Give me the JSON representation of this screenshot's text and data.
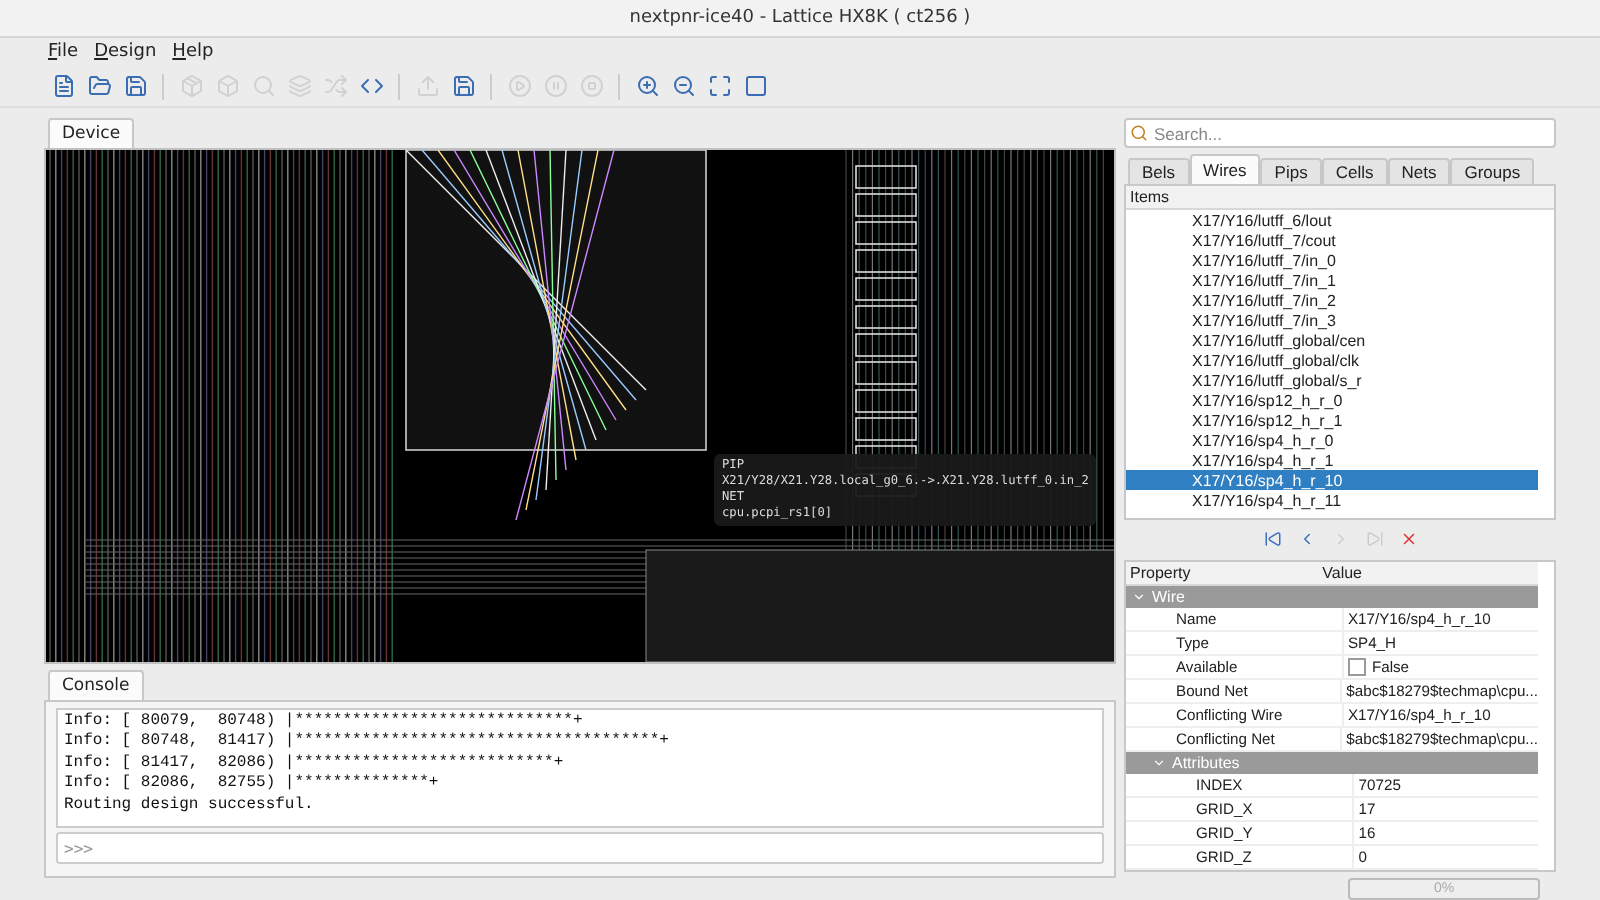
{
  "window": {
    "title": "nextpnr-ice40 - Lattice HX8K ( ct256 )"
  },
  "menu": [
    {
      "label": "File"
    },
    {
      "label": "Design"
    },
    {
      "label": "Help"
    }
  ],
  "toolbar": [
    {
      "kind": "new",
      "disabled": false
    },
    {
      "kind": "open",
      "disabled": false
    },
    {
      "kind": "save",
      "disabled": false
    },
    {
      "kind": "sep"
    },
    {
      "kind": "pack",
      "disabled": true
    },
    {
      "kind": "assign",
      "disabled": true
    },
    {
      "kind": "place",
      "disabled": true
    },
    {
      "kind": "route",
      "disabled": true
    },
    {
      "kind": "shuffle",
      "disabled": true
    },
    {
      "kind": "python",
      "disabled": false
    },
    {
      "kind": "sep"
    },
    {
      "kind": "load",
      "disabled": true
    },
    {
      "kind": "save-file",
      "disabled": false
    },
    {
      "kind": "sep"
    },
    {
      "kind": "play",
      "disabled": true
    },
    {
      "kind": "pause",
      "disabled": true
    },
    {
      "kind": "stop",
      "disabled": true
    },
    {
      "kind": "sep"
    },
    {
      "kind": "zoom-in",
      "disabled": false
    },
    {
      "kind": "zoom-out",
      "disabled": false
    },
    {
      "kind": "zoom-fit",
      "disabled": false
    },
    {
      "kind": "zoom-selected",
      "disabled": false
    }
  ],
  "device_tabs": [
    {
      "label": "Device",
      "selected": true
    }
  ],
  "tooltip": {
    "lines": [
      "PIP",
      "X21/Y28/X21.Y28.local_g0_6.->.X21.Y28.lutff_0.in_2",
      "NET",
      "cpu.pcpi_rs1[0]"
    ]
  },
  "console": {
    "tab": "Console",
    "lines": [
      "Info: [ 80079,  80748) |*****************************+",
      "Info: [ 80748,  81417) |**************************************+",
      "Info: [ 81417,  82086) |***************************+",
      "Info: [ 82086,  82755) |**************+",
      "Routing design successful."
    ],
    "placeholder": ">>>"
  },
  "search": {
    "placeholder": "Search..."
  },
  "browser_tabs": [
    {
      "label": "Bels",
      "selected": false
    },
    {
      "label": "Wires",
      "selected": true
    },
    {
      "label": "Pips",
      "selected": false
    },
    {
      "label": "Cells",
      "selected": false
    },
    {
      "label": "Nets",
      "selected": false
    },
    {
      "label": "Groups",
      "selected": false
    }
  ],
  "items": {
    "header": "Items",
    "rows": [
      {
        "label": "X17/Y16/lutff_6/lout",
        "selected": false
      },
      {
        "label": "X17/Y16/lutff_7/cout",
        "selected": false
      },
      {
        "label": "X17/Y16/lutff_7/in_0",
        "selected": false
      },
      {
        "label": "X17/Y16/lutff_7/in_1",
        "selected": false
      },
      {
        "label": "X17/Y16/lutff_7/in_2",
        "selected": false
      },
      {
        "label": "X17/Y16/lutff_7/in_3",
        "selected": false
      },
      {
        "label": "X17/Y16/lutff_global/cen",
        "selected": false
      },
      {
        "label": "X17/Y16/lutff_global/clk",
        "selected": false
      },
      {
        "label": "X17/Y16/lutff_global/s_r",
        "selected": false
      },
      {
        "label": "X17/Y16/sp12_h_r_0",
        "selected": false
      },
      {
        "label": "X17/Y16/sp12_h_r_1",
        "selected": false
      },
      {
        "label": "X17/Y16/sp4_h_r_0",
        "selected": false
      },
      {
        "label": "X17/Y16/sp4_h_r_1",
        "selected": false
      },
      {
        "label": "X17/Y16/sp4_h_r_10",
        "selected": true
      },
      {
        "label": "X17/Y16/sp4_h_r_11",
        "selected": false
      }
    ]
  },
  "nav": [
    {
      "kind": "first",
      "disabled": false
    },
    {
      "kind": "prev",
      "disabled": false
    },
    {
      "kind": "next",
      "disabled": true
    },
    {
      "kind": "last",
      "disabled": true
    },
    {
      "kind": "clear",
      "disabled": false
    }
  ],
  "properties": {
    "columns": [
      "Property",
      "Value"
    ],
    "rows": [
      {
        "kind": "section",
        "label": "Wire",
        "expanded": true,
        "children": [
          {
            "kind": "text",
            "label": "Name",
            "value": "X17/Y16/sp4_h_r_10"
          },
          {
            "kind": "text",
            "label": "Type",
            "value": "SP4_H"
          },
          {
            "kind": "checkbox",
            "label": "Available",
            "value": "False",
            "checked": false
          },
          {
            "kind": "text",
            "label": "Bound Net",
            "value": "$abc$18279$techmap\\cpu..."
          },
          {
            "kind": "text",
            "label": "Conflicting Wire",
            "value": "X17/Y16/sp4_h_r_10"
          },
          {
            "kind": "text",
            "label": "Conflicting Net",
            "value": "$abc$18279$techmap\\cpu..."
          },
          {
            "kind": "section",
            "label": "Attributes",
            "expanded": true,
            "children": [
              {
                "kind": "text",
                "label": "INDEX",
                "value": "70725"
              },
              {
                "kind": "text",
                "label": "GRID_X",
                "value": "17"
              },
              {
                "kind": "text",
                "label": "GRID_Y",
                "value": "16"
              },
              {
                "kind": "text",
                "label": "GRID_Z",
                "value": "0"
              }
            ]
          }
        ]
      }
    ]
  },
  "progress": {
    "level": 0,
    "reading": "0%"
  }
}
